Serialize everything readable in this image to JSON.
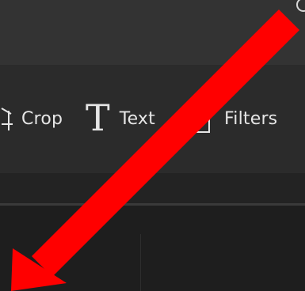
{
  "toolbar": {
    "tools": [
      {
        "label": "Crop",
        "icon": "crop-icon"
      },
      {
        "label": "Text",
        "icon": "text-icon"
      },
      {
        "label": "Filters",
        "icon": "filters-icon"
      }
    ]
  },
  "annotation": {
    "type": "arrow",
    "icon": "red-arrow-icon",
    "color": "#ff0000",
    "direction": "down-left"
  },
  "theme": {
    "titlebar_bg": "#333333",
    "toolbar_bg": "#2b2b2b",
    "canvas_bg": "#1e1e1e",
    "text_color": "#e6e6e6"
  }
}
